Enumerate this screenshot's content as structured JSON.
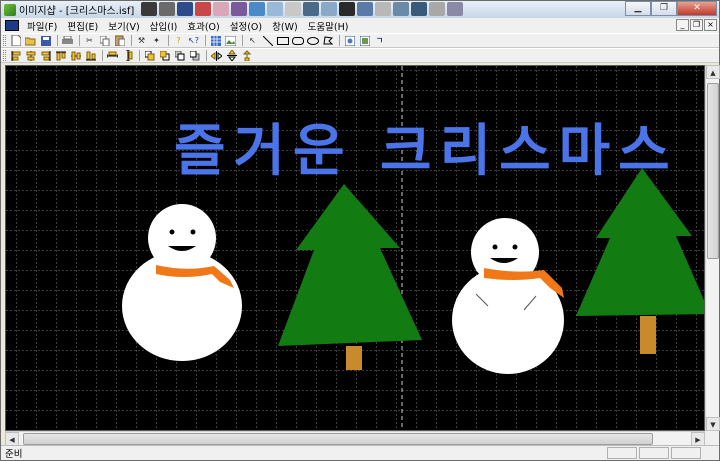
{
  "window": {
    "title": "이미지샵 - [크리스마스.isf]"
  },
  "menu": {
    "items": [
      {
        "label": "파일(F)",
        "name": "menu-file"
      },
      {
        "label": "편집(E)",
        "name": "menu-edit"
      },
      {
        "label": "보기(V)",
        "name": "menu-view"
      },
      {
        "label": "삽입(I)",
        "name": "menu-insert"
      },
      {
        "label": "효과(O)",
        "name": "menu-effect"
      },
      {
        "label": "설정(O)",
        "name": "menu-settings"
      },
      {
        "label": "창(W)",
        "name": "menu-window"
      },
      {
        "label": "도움말(H)",
        "name": "menu-help"
      }
    ]
  },
  "canvas": {
    "greeting_text": "즐거운 크리스마스",
    "background_color": "#000000",
    "grid_color": "#9a9a9a",
    "text_color": "#4a74e8",
    "tree_color": "#127c12",
    "trunk_color": "#c88a2a",
    "scarf_color": "#f07818",
    "snowman_color": "#ffffff"
  },
  "statusbar": {
    "text": "준비"
  },
  "icons": {
    "toolbar1": [
      "new-icon",
      "open-icon",
      "save-icon",
      "print-icon",
      "cut-icon",
      "copy-icon",
      "paste-icon",
      "tools-icon",
      "magic-icon",
      "help-icon",
      "context-help-icon",
      "grid-icon",
      "image-icon",
      "select-arrow-icon",
      "line-icon",
      "rectangle-icon",
      "rounded-rectangle-icon",
      "ellipse-icon",
      "polygon-icon",
      "insert-picture-icon",
      "insert-object-icon",
      "text-icon"
    ],
    "toolbar2": [
      "align-left-icon",
      "align-center-icon",
      "align-right-icon",
      "align-top-icon",
      "align-middle-icon",
      "align-bottom-icon",
      "same-width-icon",
      "same-height-icon",
      "bring-front-icon",
      "send-back-icon",
      "bring-forward-icon",
      "send-backward-icon",
      "flip-horizontal-icon",
      "flip-vertical-icon",
      "rotate-icon"
    ]
  }
}
